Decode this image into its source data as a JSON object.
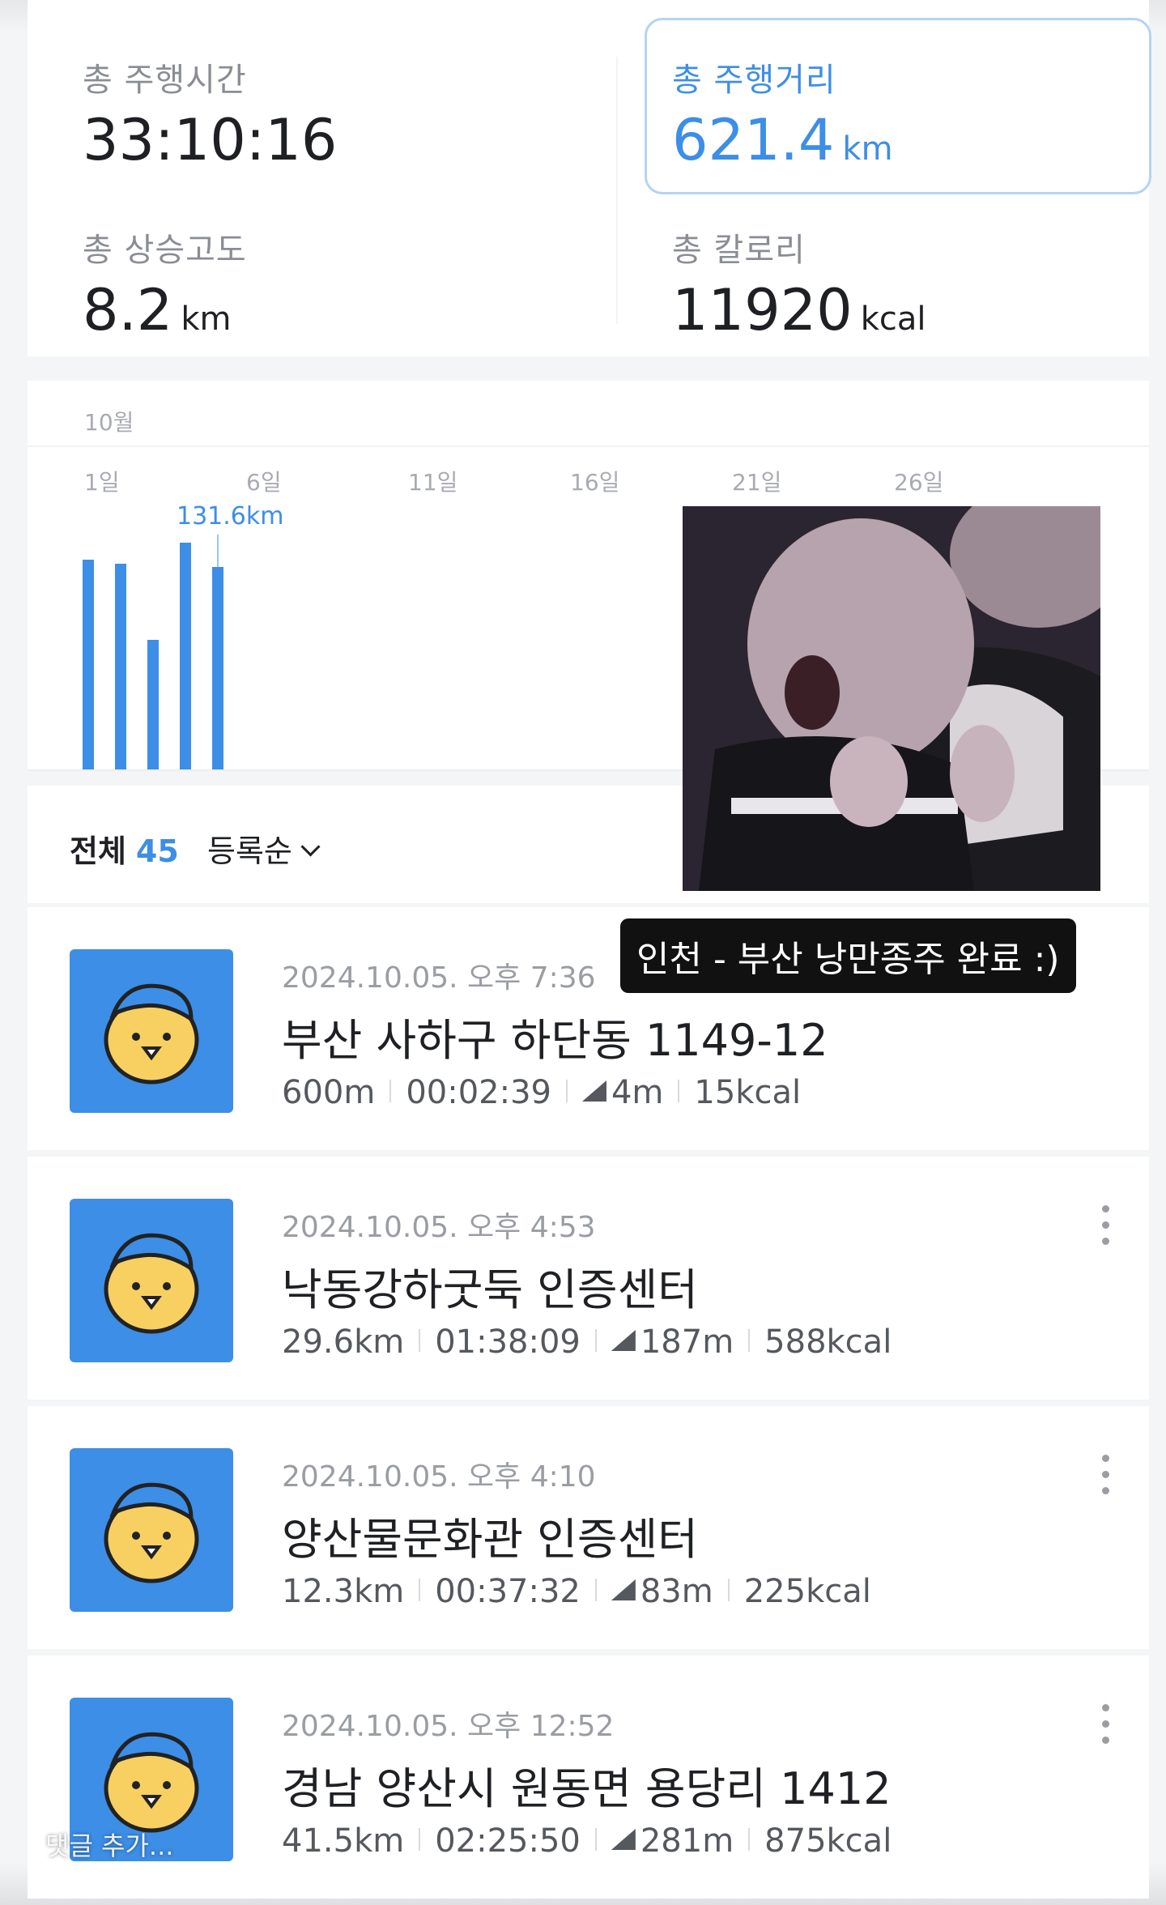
{
  "stats": {
    "total_time": {
      "label": "총 주행시간",
      "value": "33:10:16",
      "unit": ""
    },
    "total_distance": {
      "label": "총 주행거리",
      "value": "621.4",
      "unit": "km"
    },
    "total_elevation": {
      "label": "총 상승고도",
      "value": "8.2",
      "unit": "km"
    },
    "total_calories": {
      "label": "총 칼로리",
      "value": "11920",
      "unit": "kcal"
    }
  },
  "chart": {
    "month": "10월",
    "ticks": [
      "1일",
      "6일",
      "11일",
      "16일",
      "21일",
      "26일"
    ],
    "highlight_label": "131.6km",
    "accent_color": "#3d8ee6"
  },
  "chart_data": {
    "type": "bar",
    "title": "",
    "categories": [
      "1",
      "2",
      "3",
      "4",
      "5"
    ],
    "values": [
      121,
      119,
      75,
      131,
      117
    ],
    "xlabel": "",
    "ylabel": "",
    "ylim": [
      0,
      160
    ],
    "grid": false,
    "highlight_value_label": "131.6km"
  },
  "filter": {
    "all_label": "전체",
    "count": "45",
    "sort_label": "등록순"
  },
  "rides": [
    {
      "date": "2024.10.05. 오후 7:36",
      "title": "부산 사하구 하단동 1149-12",
      "distance": "600m",
      "duration": "00:02:39",
      "climb": "4m",
      "kcal": "15kcal"
    },
    {
      "date": "2024.10.05. 오후 4:53",
      "title": "낙동강하굿둑 인증센터",
      "distance": "29.6km",
      "duration": "01:38:09",
      "climb": "187m",
      "kcal": "588kcal"
    },
    {
      "date": "2024.10.05. 오후 4:10",
      "title": "양산물문화관 인증센터",
      "distance": "12.3km",
      "duration": "00:37:32",
      "climb": "83m",
      "kcal": "225kcal"
    },
    {
      "date": "2024.10.05. 오후 12:52",
      "title": "경남 양산시 원동면 용당리 1412",
      "distance": "41.5km",
      "duration": "02:25:50",
      "climb": "281m",
      "kcal": "875kcal"
    }
  ],
  "overlay": {
    "caption": "인천 - 부산 낭만종주 완료 :)",
    "comment_placeholder": "댓글 추가..."
  }
}
